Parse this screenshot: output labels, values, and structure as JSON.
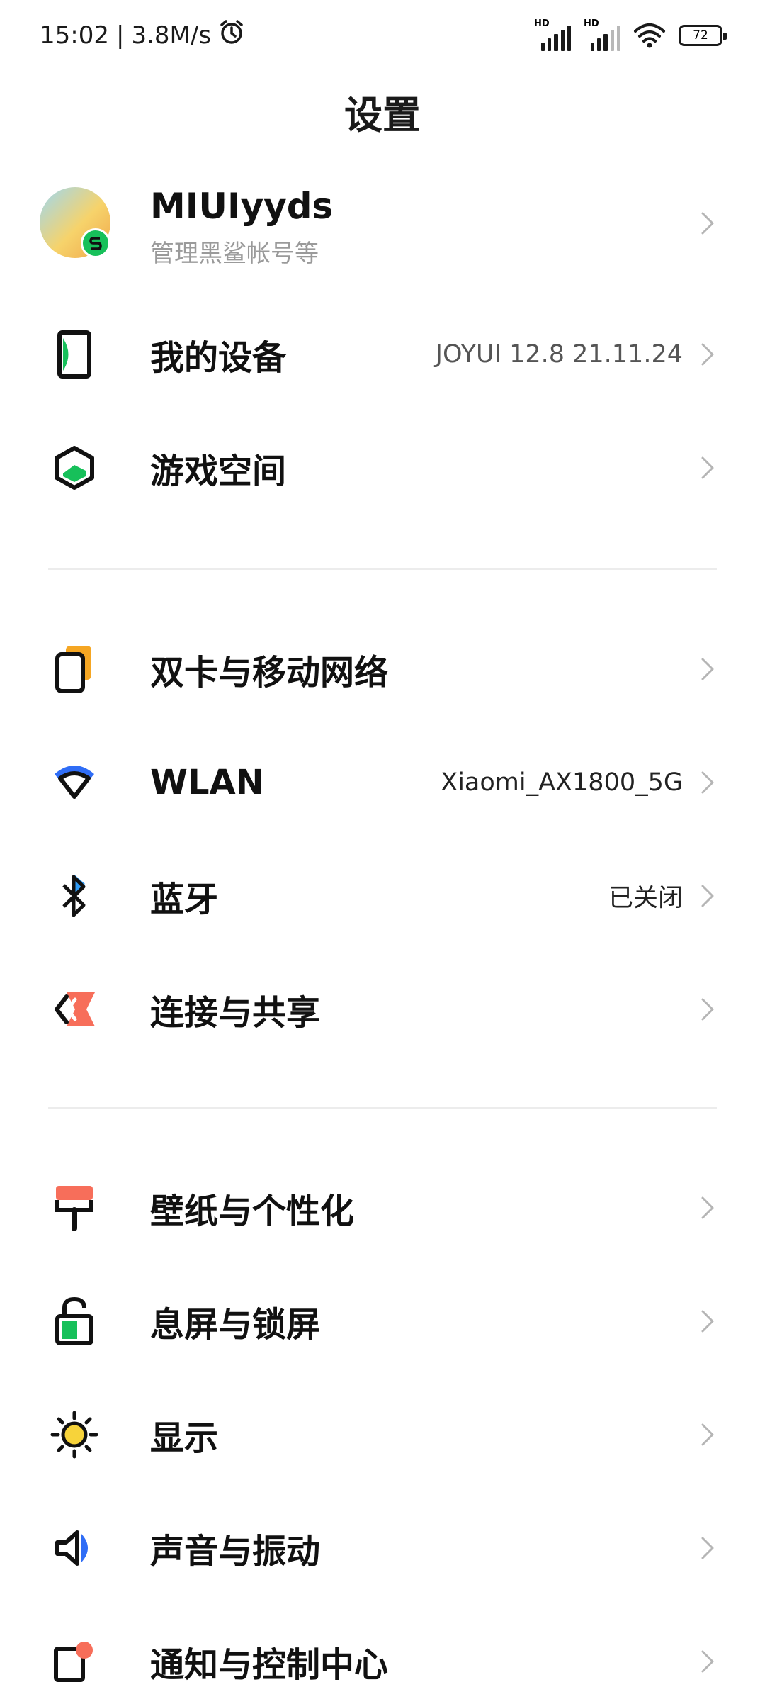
{
  "status_bar": {
    "time": "15:02",
    "separator": "|",
    "speed": "3.8M/s",
    "hd1": "HD",
    "hd2": "HD",
    "battery": "72"
  },
  "page": {
    "title": "设置"
  },
  "account": {
    "name": "MIUIyyds",
    "subtitle": "管理黑鲨帐号等"
  },
  "rows": {
    "my_device": {
      "label": "我的设备",
      "value": "JOYUI 12.8 21.11.24"
    },
    "game_space": {
      "label": "游戏空间"
    },
    "dual_sim": {
      "label": "双卡与移动网络"
    },
    "wlan": {
      "label": "WLAN",
      "value": "Xiaomi_AX1800_5G"
    },
    "bluetooth": {
      "label": "蓝牙",
      "value": "已关闭"
    },
    "connection": {
      "label": "连接与共享"
    },
    "wallpaper": {
      "label": "壁纸与个性化"
    },
    "lockscreen": {
      "label": "息屏与锁屏"
    },
    "display": {
      "label": "显示"
    },
    "sound": {
      "label": "声音与振动"
    },
    "notification": {
      "label": "通知与控制中心"
    }
  },
  "colors": {
    "accent_green": "#17c05a",
    "accent_blue": "#2f6df6",
    "accent_orange": "#f5a623",
    "accent_coral": "#f76e5a",
    "accent_yellow": "#f7d33a"
  }
}
